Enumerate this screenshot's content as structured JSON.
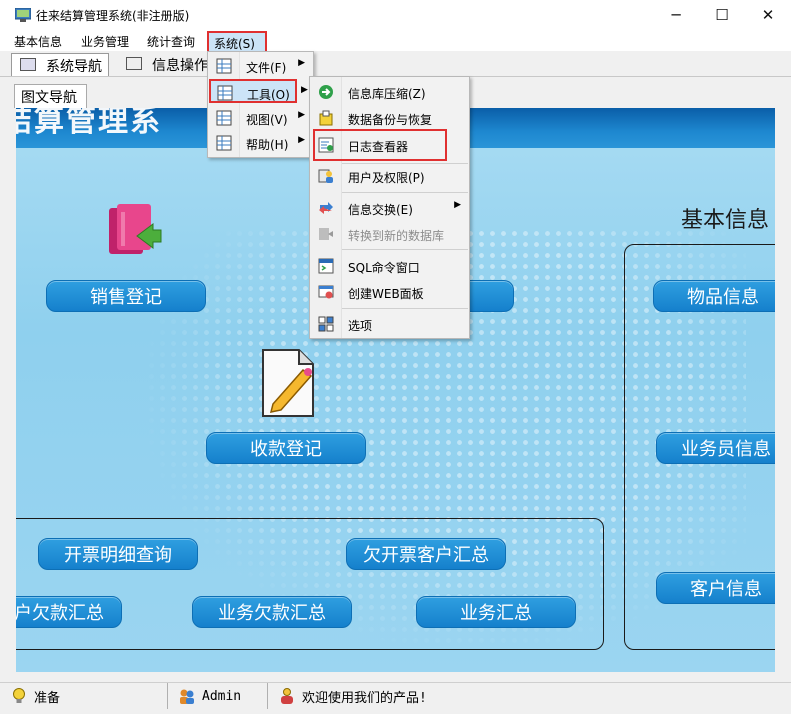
{
  "window": {
    "title": "往来结算管理系统(非注册版)",
    "controls": {
      "minimize": "─",
      "maximize": "☐",
      "close": "✕"
    }
  },
  "menubar": {
    "items": [
      "基本信息",
      "业务管理",
      "统计查询",
      "系统(S)"
    ]
  },
  "tabs": [
    {
      "label": "系统导航",
      "active": true
    },
    {
      "label": "信息操作",
      "active": false
    }
  ],
  "subtab": {
    "label": "图文导航"
  },
  "panel": {
    "banner_text": "结算管理系",
    "heading_basic": "基本信息",
    "buttons": {
      "sales_register": "销售登记",
      "payment_register": "收款登记",
      "item_info": "物品信息",
      "salesman_info": "业务员信息",
      "customer_info": "客户信息",
      "invoice_detail_query": "开票明细查询",
      "unbilled_customer_summary": "欠开票客户汇总",
      "customer_debt_summary": "户欠款汇总",
      "business_debt_summary": "业务欠款汇总",
      "business_summary": "业务汇总"
    }
  },
  "system_menu": {
    "items": [
      {
        "label": "文件(F)",
        "icon": "grid-icon",
        "submenu": true
      },
      {
        "label": "工具(O)",
        "icon": "grid-icon",
        "submenu": true,
        "highlighted": true
      },
      {
        "label": "视图(V)",
        "icon": "grid-icon",
        "submenu": true
      },
      {
        "label": "帮助(H)",
        "icon": "grid-icon",
        "submenu": true
      }
    ]
  },
  "tools_menu": {
    "items": [
      {
        "label": "信息库压缩(Z)",
        "icon": "compress-icon"
      },
      {
        "label": "数据备份与恢复",
        "icon": "backup-icon"
      },
      {
        "label": "日志查看器",
        "icon": "log-icon",
        "boxed": true
      },
      {
        "label": "用户及权限(P)",
        "icon": "user-permission-icon"
      },
      {
        "label": "信息交换(E)",
        "icon": "exchange-icon",
        "submenu": true
      },
      {
        "label": "转换到新的数据库",
        "icon": "convert-db-icon",
        "disabled": true
      },
      {
        "label": "SQL命令窗口",
        "icon": "sql-window-icon"
      },
      {
        "label": "创建WEB面板",
        "icon": "web-panel-icon"
      },
      {
        "label": "选项",
        "icon": "options-icon"
      }
    ]
  },
  "statusbar": {
    "ready": "准备",
    "user": "Admin",
    "welcome": "欢迎使用我们的产品!"
  },
  "colors": {
    "accent_blue": "#1580cc",
    "highlight_red": "#e03030",
    "menu_highlight": "#cce4f7"
  }
}
